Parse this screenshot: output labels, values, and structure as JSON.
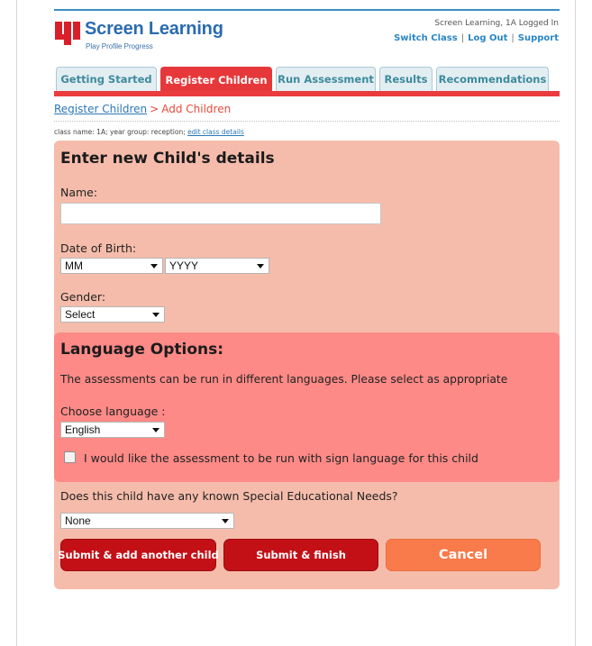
{
  "header": {
    "logo_title": "Screen Learning",
    "logo_tagline": "Play Profile Progress",
    "status_text": "Screen Learning, 1A Logged In",
    "links": [
      "Switch Class",
      "Log Out",
      "Support"
    ]
  },
  "tabs": [
    {
      "label": "Getting Started",
      "active": false
    },
    {
      "label": "Register Children",
      "active": true
    },
    {
      "label": "Run Assessment",
      "active": false
    },
    {
      "label": "Results",
      "active": false
    },
    {
      "label": "Recommendations",
      "active": false
    }
  ],
  "breadcrumb": {
    "parent": "Register Children",
    "separator": ">",
    "current": "Add Children"
  },
  "class_info": {
    "text": "class name: 1A; year group: reception;",
    "edit_link": "edit class details"
  },
  "child_details": {
    "heading": "Enter new Child's details",
    "name_label": "Name:",
    "name_value": "",
    "dob_label": "Date of Birth:",
    "dob_month_selected": "MM",
    "dob_year_selected": "YYYY",
    "gender_label": "Gender:",
    "gender_selected": "Select"
  },
  "language_options": {
    "heading": "Language Options:",
    "description": "The assessments can be run in different languages. Please select as appropriate",
    "choose_label": "Choose language :",
    "language_selected": "English",
    "sign_language_label": "I would like the assessment to be run with sign language for this child",
    "sign_language_checked": false
  },
  "special_needs": {
    "question": "Does this child have any known Special Educational Needs?",
    "selected": "None"
  },
  "buttons": {
    "submit_add": "Submit & add another child",
    "submit_finish": "Submit & finish",
    "cancel": "Cancel"
  },
  "colors": {
    "brand_blue": "#2a6bb0",
    "tab_active": "#e6383a",
    "panel": "#f6bcab",
    "language_panel": "#fd8a87",
    "button_red": "#c31017",
    "button_orange": "#f97a4a"
  }
}
